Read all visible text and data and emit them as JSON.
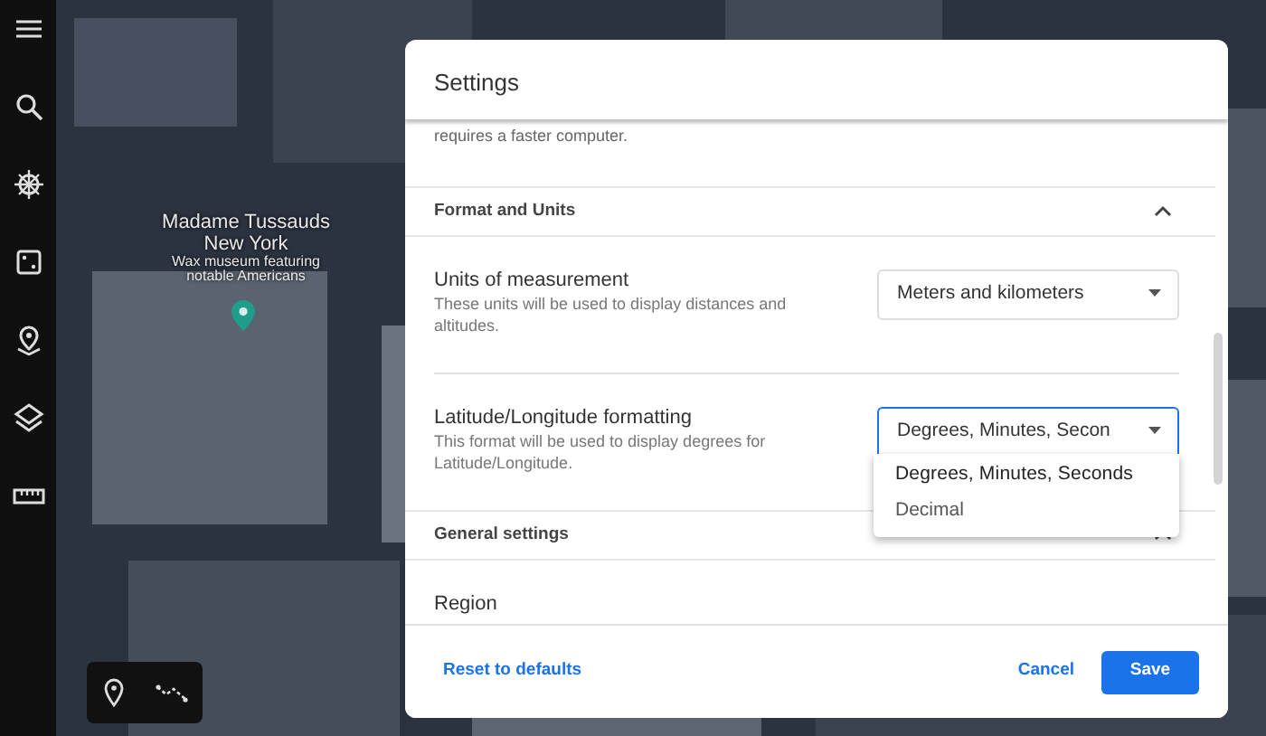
{
  "map": {
    "place": {
      "title_lines": [
        "Madame Tussauds",
        "New York"
      ],
      "subtitle_lines": [
        "Wax museum featuring",
        "notable Americans"
      ]
    }
  },
  "dialog": {
    "title": "Settings",
    "cut_text": "requires a faster computer.",
    "sections": [
      {
        "title": "Format and Units",
        "expanded": true,
        "settings": [
          {
            "label": "Units of measurement",
            "description": "These units will be used to display distances and altitudes.",
            "value": "Meters and kilometers",
            "open": false
          },
          {
            "label": "Latitude/Longitude formatting",
            "description": "This format will be used to display degrees for Latitude/Longitude.",
            "value": "Degrees, Minutes, Secon",
            "open": true,
            "options": [
              {
                "label": "Degrees, Minutes, Seconds",
                "selected": true
              },
              {
                "label": "Decimal",
                "selected": false
              }
            ]
          }
        ]
      },
      {
        "title": "General settings",
        "expanded": true,
        "settings": [
          {
            "label": "Region"
          }
        ]
      }
    ],
    "reset": "Reset to defaults",
    "cancel": "Cancel",
    "save": "Save"
  }
}
